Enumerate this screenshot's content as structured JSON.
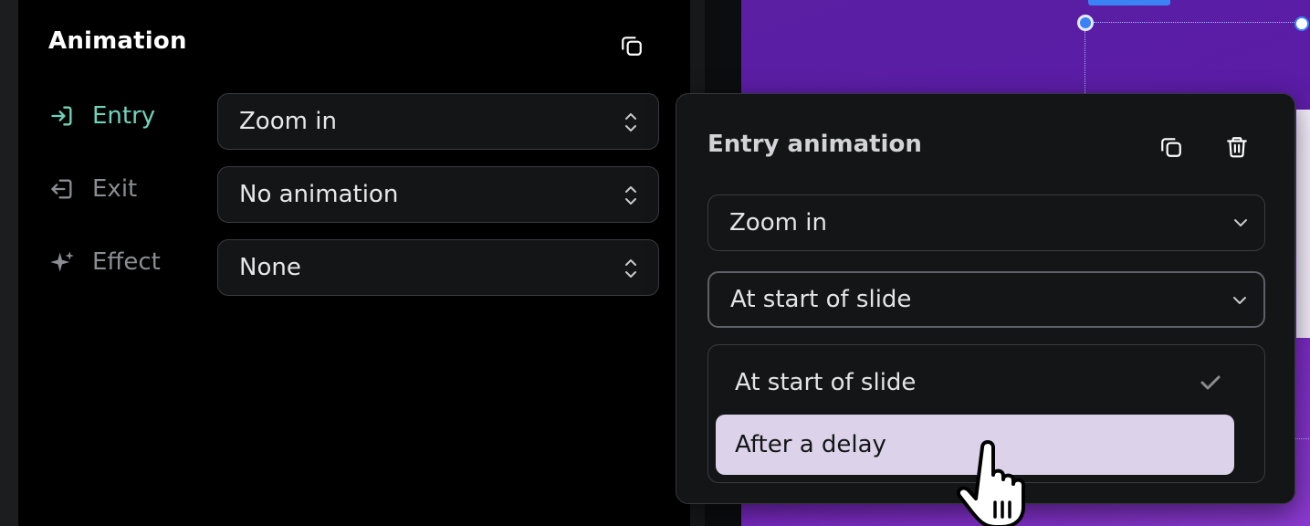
{
  "panel": {
    "title": "Animation",
    "rows": [
      {
        "label": "Entry",
        "value": "Zoom in",
        "icon": "entry-icon"
      },
      {
        "label": "Exit",
        "value": "No animation",
        "icon": "exit-icon"
      },
      {
        "label": "Effect",
        "value": "None",
        "icon": "sparkle-icon"
      }
    ]
  },
  "popover": {
    "title": "Entry animation",
    "animation_select": "Zoom in",
    "timing_select": "At start of slide",
    "dropdown_options": [
      {
        "label": "At start of slide",
        "selected": true
      },
      {
        "label": "After a delay",
        "highlighted": true
      }
    ]
  },
  "colors": {
    "accent": "#6fd3bb",
    "highlight": "#dcd3ea",
    "canvas": "#5a1fa3",
    "selection": "#3b82f6"
  }
}
